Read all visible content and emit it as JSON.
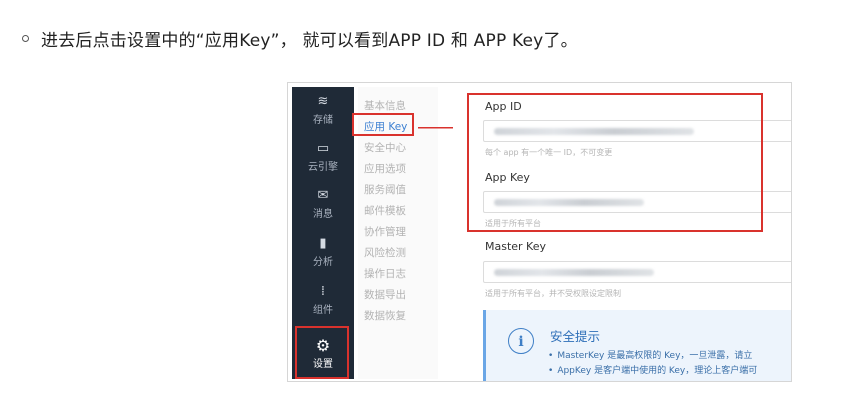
{
  "instruction": {
    "text": "进去后点击设置中的“应用Key”， 就可以看到APP ID 和 APP Key了。"
  },
  "rail": {
    "items": [
      {
        "icon": "database-icon",
        "glyph": "≋",
        "label": "存储"
      },
      {
        "icon": "cloud-engine-icon",
        "glyph": "▭",
        "label": "云引擎"
      },
      {
        "icon": "message-icon",
        "glyph": "✉",
        "label": "消息"
      },
      {
        "icon": "chart-icon",
        "glyph": "▮",
        "label": "分析"
      },
      {
        "icon": "components-icon",
        "glyph": "⁞",
        "label": "组件"
      },
      {
        "icon": "gear-icon",
        "glyph": "⚙",
        "label": "设置"
      }
    ]
  },
  "menu": {
    "items": [
      "基本信息",
      "应用 Key",
      "安全中心",
      "应用选项",
      "服务阈值",
      "邮件模板",
      "协作管理",
      "风险检测",
      "操作日志",
      "数据导出",
      "数据恢复"
    ],
    "selected": "应用 Key"
  },
  "fields": {
    "app_id": {
      "label": "App ID",
      "help": "每个 app 有一个唯一 ID，不可变更"
    },
    "app_key": {
      "label": "App Key",
      "help": "适用于所有平台"
    },
    "master_key": {
      "label": "Master Key",
      "help": "适用于所有平台，并不受权限设定限制"
    }
  },
  "tip": {
    "title": "安全提示",
    "lines": [
      "MasterKey 是最高权限的 Key，一旦泄露，请立",
      "AppKey 是客户端中使用的 Key，理论上客户端可"
    ]
  },
  "colors": {
    "highlight": "#d9322d",
    "rail_bg": "#1f2a37",
    "link": "#3b7fd1",
    "tip_bg": "#edf4fc"
  }
}
